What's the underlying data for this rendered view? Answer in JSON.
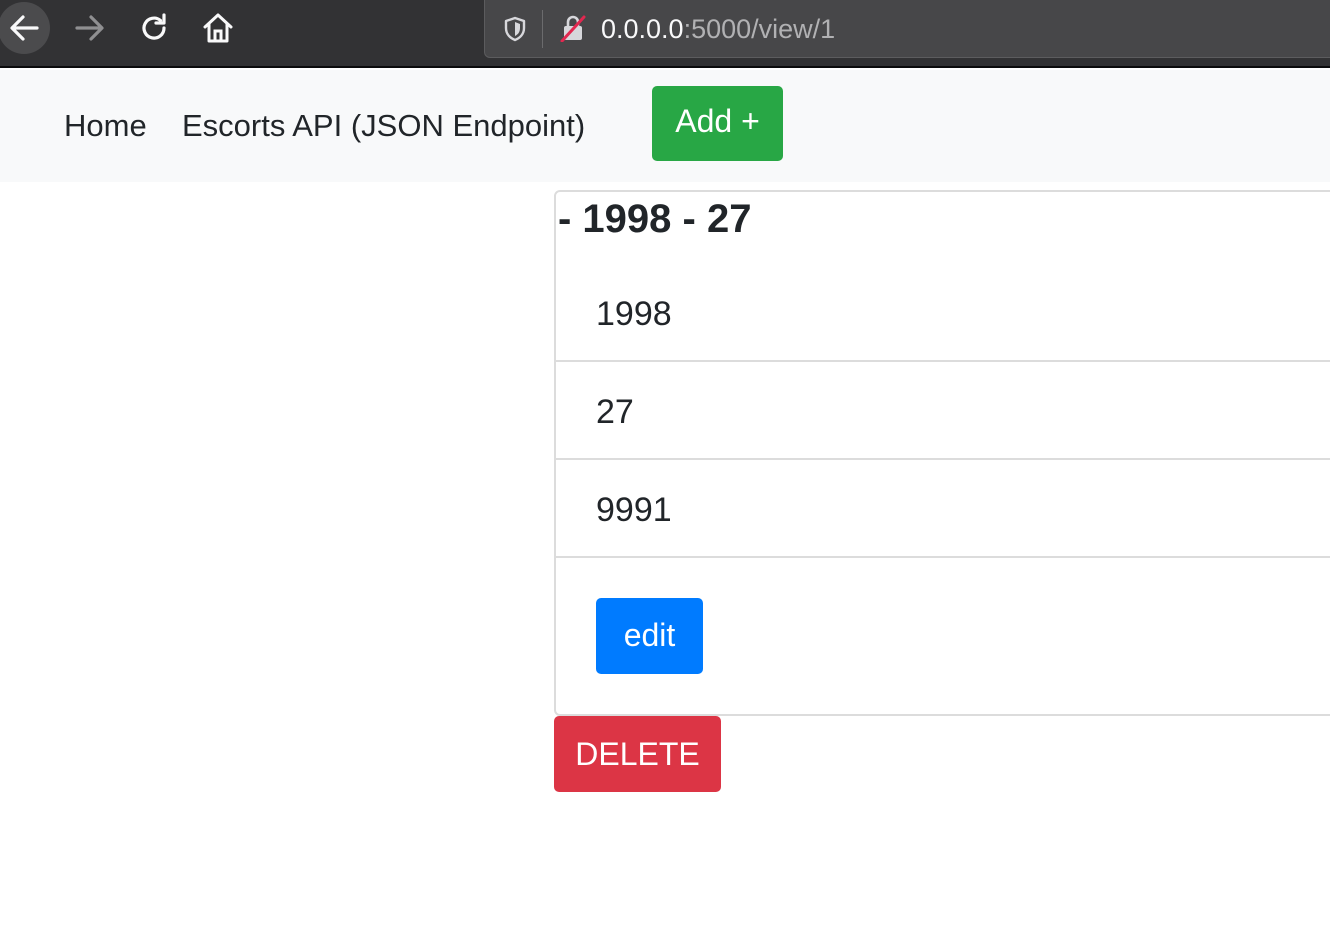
{
  "browser": {
    "url_host": "0.0.0.0",
    "url_rest": ":5000/view/1",
    "icons": [
      "back-arrow-icon",
      "forward-arrow-icon",
      "reload-icon",
      "home-icon",
      "shield-icon",
      "insecure-lock-icon"
    ]
  },
  "navbar": {
    "home_label": "Home",
    "api_label": "Escorts API (JSON Endpoint)",
    "add_label": "Add +"
  },
  "card": {
    "title": "- 1998 - 27",
    "items": [
      "1998",
      "27",
      "9991"
    ],
    "edit_label": "edit"
  },
  "delete_label": "DELETE",
  "colors": {
    "add": "#28a745",
    "edit": "#007bff",
    "delete": "#dc3545",
    "navbar_bg": "#f8f9fa",
    "browser_bg": "#323234"
  }
}
